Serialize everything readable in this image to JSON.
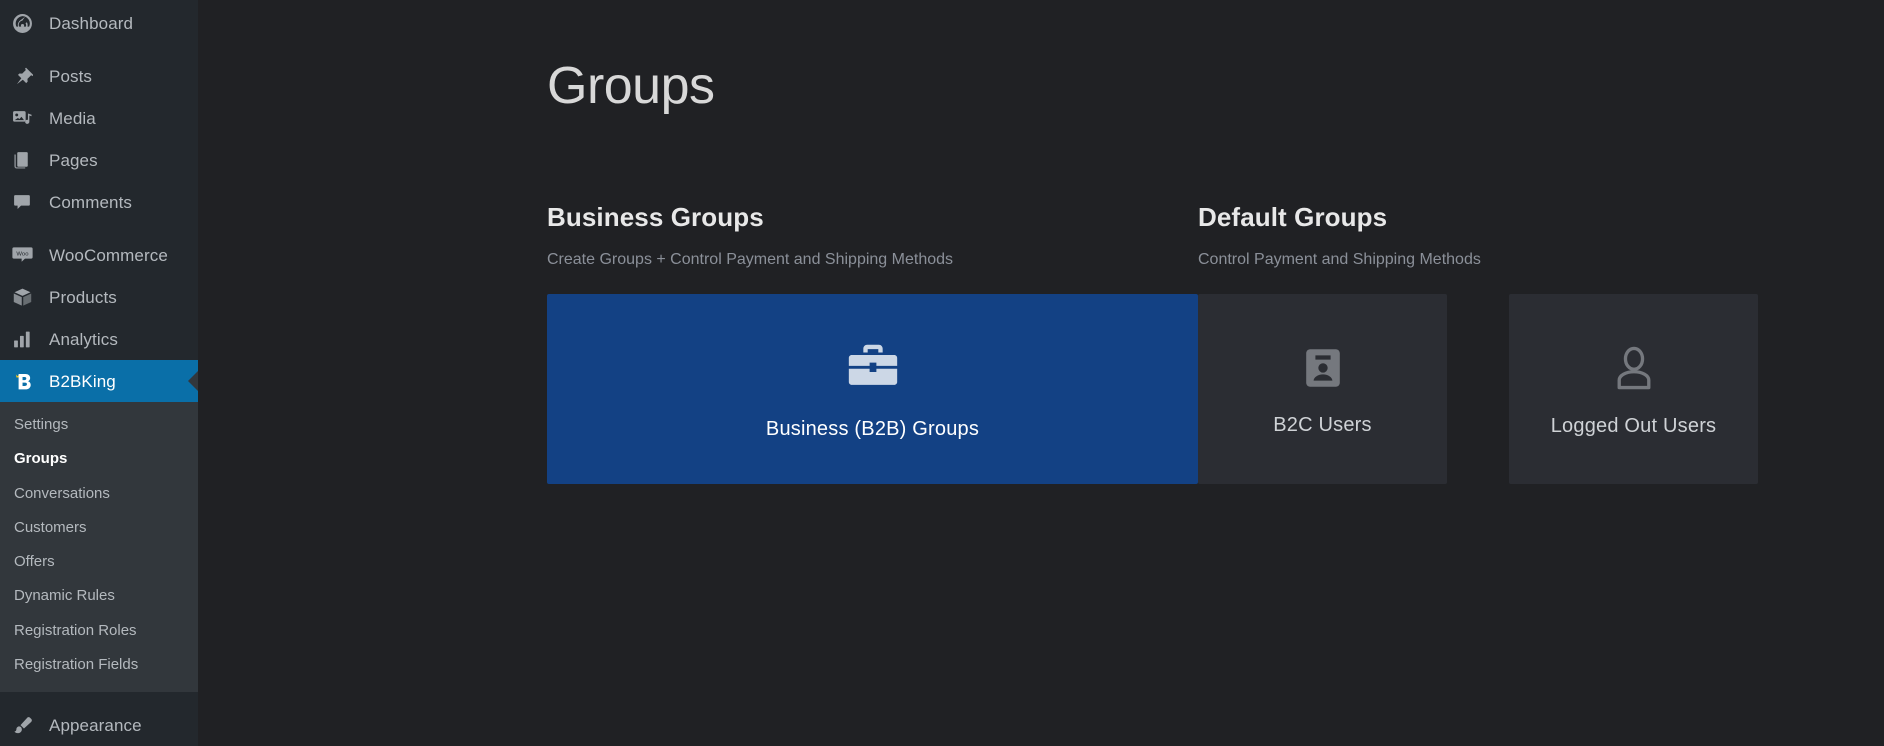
{
  "sidebar": {
    "items": [
      {
        "label": "Dashboard",
        "icon": "dashboard-icon",
        "id": "dashboard"
      },
      {
        "label": "Posts",
        "icon": "pin-icon",
        "id": "posts"
      },
      {
        "label": "Media",
        "icon": "media-icon",
        "id": "media"
      },
      {
        "label": "Pages",
        "icon": "pages-icon",
        "id": "pages"
      },
      {
        "label": "Comments",
        "icon": "comment-icon",
        "id": "comments"
      },
      {
        "label": "WooCommerce",
        "icon": "woo-icon",
        "id": "woocommerce"
      },
      {
        "label": "Products",
        "icon": "box-icon",
        "id": "products"
      },
      {
        "label": "Analytics",
        "icon": "bar-chart-icon",
        "id": "analytics"
      },
      {
        "label": "B2BKing",
        "icon": "b2bking-icon",
        "id": "b2bking"
      },
      {
        "label": "Appearance",
        "icon": "brush-icon",
        "id": "appearance"
      }
    ],
    "submenu": [
      {
        "label": "Settings",
        "active": false
      },
      {
        "label": "Groups",
        "active": true
      },
      {
        "label": "Conversations",
        "active": false
      },
      {
        "label": "Customers",
        "active": false
      },
      {
        "label": "Offers",
        "active": false
      },
      {
        "label": "Dynamic Rules",
        "active": false
      },
      {
        "label": "Registration Roles",
        "active": false
      },
      {
        "label": "Registration Fields",
        "active": false
      }
    ]
  },
  "page": {
    "title": "Groups"
  },
  "business": {
    "heading": "Business Groups",
    "subheading": "Create Groups + Control Payment and Shipping Methods",
    "card": {
      "label": "Business (B2B) Groups",
      "icon": "briefcase-icon"
    }
  },
  "defaults": {
    "heading": "Default Groups",
    "subheading": "Control Payment and Shipping Methods",
    "cards": [
      {
        "label": "B2C Users",
        "icon": "id-badge-icon"
      },
      {
        "label": "Logged Out Users",
        "icon": "person-outline-icon"
      }
    ]
  },
  "colors": {
    "admin_background": "#202124",
    "sidebar_background": "#23282d",
    "submenu_background": "#32373c",
    "current_menu_blue": "#0a6fa8",
    "business_card_blue": "#134184",
    "default_card_gray": "#2b2d33",
    "muted_text": "#8b9099"
  }
}
